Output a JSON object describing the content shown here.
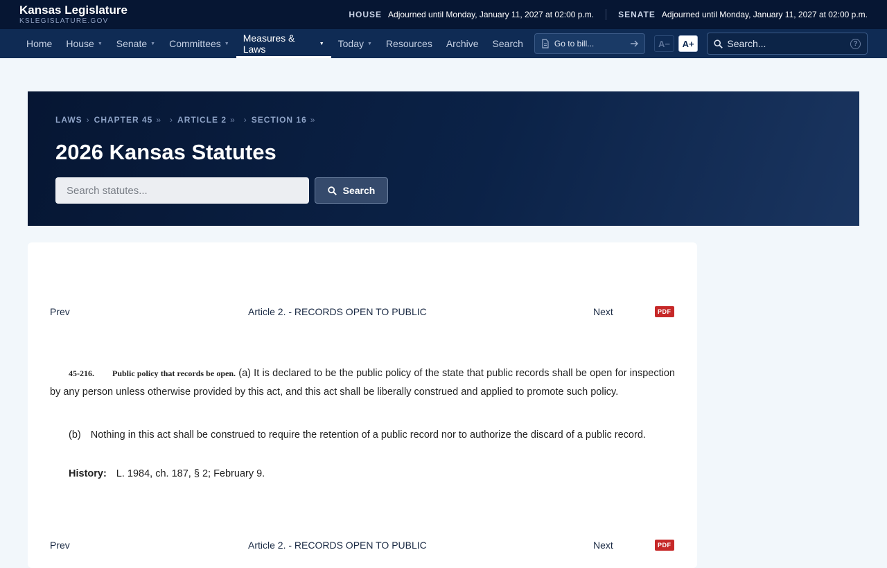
{
  "site": {
    "title": "Kansas Legislature",
    "domain": "KSLEGISLATURE.GOV"
  },
  "status": {
    "house_label": "HOUSE",
    "house_text": "Adjourned until Monday, January 11, 2027 at 02:00 p.m.",
    "senate_label": "SENATE",
    "senate_text": "Adjourned until Monday, January 11, 2027 at 02:00 p.m."
  },
  "nav": {
    "items": [
      {
        "label": "Home"
      },
      {
        "label": "House"
      },
      {
        "label": "Senate"
      },
      {
        "label": "Committees"
      },
      {
        "label": "Measures & Laws"
      },
      {
        "label": "Today"
      },
      {
        "label": "Resources"
      },
      {
        "label": "Archive"
      },
      {
        "label": "Search"
      }
    ],
    "active": "Measures & Laws",
    "goto_placeholder": "Go to bill...",
    "font_decrease": "A−",
    "font_increase": "A+",
    "search_placeholder": "Search...",
    "help": "?"
  },
  "breadcrumb": [
    "LAWS",
    "CHAPTER 45",
    "ARTICLE 2",
    "SECTION 16"
  ],
  "hero": {
    "title": "2026 Kansas Statutes",
    "search_placeholder": "Search statutes...",
    "search_button": "Search"
  },
  "article_nav": {
    "prev": "Prev",
    "title": "Article 2. - RECORDS OPEN TO PUBLIC",
    "next": "Next",
    "pdf": "PDF"
  },
  "statute": {
    "number": "45-216.",
    "catchline": "Public policy that records be open.",
    "subsection_a": "(a) It is declared to be the public policy of the state that public records shall be open for inspection by any person unless otherwise provided by this act, and this act shall be liberally construed and applied to promote such policy.",
    "subsection_b_label": "(b)",
    "subsection_b": "Nothing in this act shall be construed to require the retention of a public record nor to authorize the discard of a public record.",
    "history_label": "History:",
    "history_text": "L. 1984, ch. 187, § 2; February 9."
  },
  "colors": {
    "topbar": "#061633",
    "navbar": "#0f2b54",
    "page_bg": "#f2f7fb",
    "pdf_badge": "#c62828"
  }
}
